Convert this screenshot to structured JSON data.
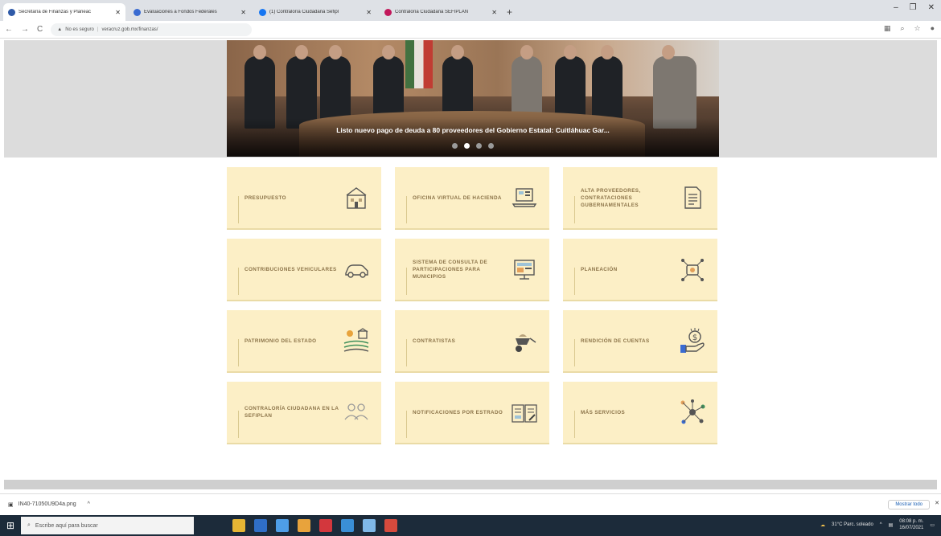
{
  "browser": {
    "tabs": [
      {
        "label": "Secretaría de Finanzas y Planeac",
        "favicon_color": "#2f5aa8",
        "active": true
      },
      {
        "label": "Evaluaciones a Fondos Federales",
        "favicon_color": "#3a6bd1",
        "active": false
      },
      {
        "label": "(1) Contraloría Ciudadana Sefipl",
        "favicon_color": "#1877f2",
        "active": false
      },
      {
        "label": "Contraloría Ciudadana SEFIPLAN",
        "favicon_color": "#c2185b",
        "active": false
      }
    ],
    "new_tab_label": "+",
    "address": {
      "warning": "No es seguro",
      "url": "veracruz.gob.mx/finanzas/"
    },
    "nav": {
      "back": "←",
      "forward": "→",
      "reload": "C"
    },
    "window_controls": {
      "minimize": "–",
      "maximize": "❐",
      "close": "✕"
    }
  },
  "hero": {
    "caption": "Listo nuevo pago de deuda a 80 proveedores del Gobierno Estatal: Cuitláhuac Gar...",
    "slides": 4,
    "active_slide": 2
  },
  "services": [
    {
      "label": "PRESUPUESTO",
      "icon": "budget-building-icon"
    },
    {
      "label": "OFICINA VIRTUAL DE HACIENDA",
      "icon": "virtual-office-laptop-icon"
    },
    {
      "label": "ALTA PROVEEDORES, CONTRATACIONES GUBERNAMENTALES",
      "icon": "document-list-icon"
    },
    {
      "label": "CONTRIBUCIONES VEHICULARES",
      "icon": "car-icon"
    },
    {
      "label": "SISTEMA DE CONSULTA DE PARTICIPACIONES PARA MUNICIPIOS",
      "icon": "monitor-icon"
    },
    {
      "label": "PLANEACIÓN",
      "icon": "planning-network-icon"
    },
    {
      "label": "PATRIMONIO DEL ESTADO",
      "icon": "land-property-icon"
    },
    {
      "label": "CONTRATISTAS",
      "icon": "wheelbarrow-icon"
    },
    {
      "label": "RENDICIÓN DE CUENTAS",
      "icon": "hand-money-icon"
    },
    {
      "label": "CONTRALORÍA CIUDADANA EN LA SEFIPLAN",
      "icon": "people-group-icon"
    },
    {
      "label": "NOTIFICACIONES POR ESTRADO",
      "icon": "open-book-icon"
    },
    {
      "label": "MÁS SERVICIOS",
      "icon": "nodes-icon"
    }
  ],
  "download": {
    "file": "IN40-71050U9D4a.png",
    "chevron": "^",
    "show_all": "Mostrar todo",
    "close": "✕"
  },
  "taskbar": {
    "search_placeholder": "Escribe aquí para buscar",
    "weather": "31°C Parc. soleado",
    "time": "08:08 p. m.",
    "date": "16/07/2021",
    "app_colors": [
      "#e5b534",
      "#2f6ec7",
      "#4e9ee8",
      "#e8a33c",
      "#d3373d",
      "#3a8fd6",
      "#7fb8e8",
      "#d64a3d"
    ]
  },
  "colors": {
    "card_bg": "#fcefc6",
    "card_text": "#8b7348",
    "accent_icon": "#333333"
  }
}
